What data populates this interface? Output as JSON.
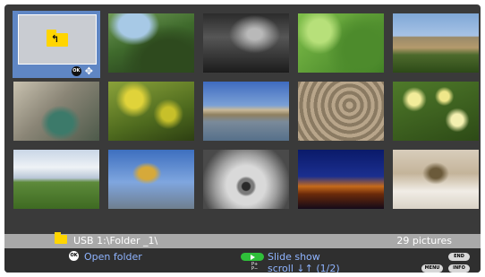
{
  "grid": {
    "tiles": [
      {
        "name": "folder-up-tile",
        "selected": true,
        "ok_badge": "OK"
      },
      {
        "name": "thumb-forest"
      },
      {
        "name": "thumb-dark-water"
      },
      {
        "name": "thumb-green-leaves"
      },
      {
        "name": "thumb-hilltop-town"
      },
      {
        "name": "thumb-street-sign"
      },
      {
        "name": "thumb-yellow-flowers-bush"
      },
      {
        "name": "thumb-riverside-chateau"
      },
      {
        "name": "thumb-stone-carving"
      },
      {
        "name": "thumb-daffodils"
      },
      {
        "name": "thumb-field-clouds"
      },
      {
        "name": "thumb-golden-statue"
      },
      {
        "name": "thumb-dandelion"
      },
      {
        "name": "thumb-night-castle"
      },
      {
        "name": "thumb-fountain"
      }
    ]
  },
  "status": {
    "path": "USB 1:\\Folder _1\\",
    "count": "29 pictures"
  },
  "help": {
    "ok_key": "OK",
    "open_folder": "Open folder",
    "slide_show": "Slide show",
    "pp_key": "P+\nP−",
    "scroll": "scroll ↓↑ (1/2)",
    "end_key": "END",
    "menu_key": "MENU",
    "info_key": "INFO"
  }
}
